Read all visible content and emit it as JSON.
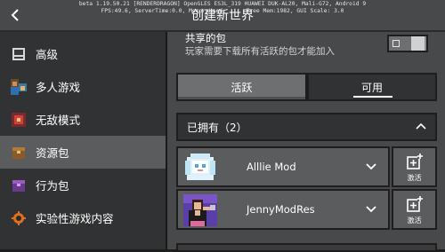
{
  "topbar": {
    "debug_line_1": "beta 1.19.50.21 [RENDERDRAGON] OpenGLES ES3L_319 HUAWEI DUK-AL20, Mali-G72, Android 9",
    "debug_line_2": "FPS:49.6, ServerTime:0.0, MemoryUsed:      Free Mem:1982, GUI Scale: 3.0",
    "title": "创建新世界",
    "back_icon": "chevron-left-icon"
  },
  "sidebar": {
    "items": [
      {
        "label": "高级",
        "icon": "advanced-icon"
      },
      {
        "label": "多人游戏",
        "icon": "multiplayer-icon"
      },
      {
        "label": "无敌模式",
        "icon": "cheats-icon"
      },
      {
        "label": "资源包",
        "icon": "resource-pack-icon",
        "active": true
      },
      {
        "label": "行为包",
        "icon": "behavior-pack-icon"
      },
      {
        "label": "实验性游戏内容",
        "icon": "experimental-icon"
      }
    ]
  },
  "main": {
    "shared_title": "共享的包",
    "shared_desc": "玩家需要下载所有活跃的包才能加入",
    "toggle_on": false,
    "tabs": [
      {
        "label": "活跃"
      },
      {
        "label": "可用",
        "selected": true
      }
    ],
    "owned_header": "已拥有（2）",
    "packs": [
      {
        "name": "Alllie Mod",
        "activate_label": "激活"
      },
      {
        "name": "JennyModRes",
        "activate_label": "激活"
      }
    ]
  },
  "colors": {
    "background": "#48494a",
    "sidebar": "#313233",
    "sidebar_active": "#5b5c5e",
    "border": "#1e1e1f"
  }
}
